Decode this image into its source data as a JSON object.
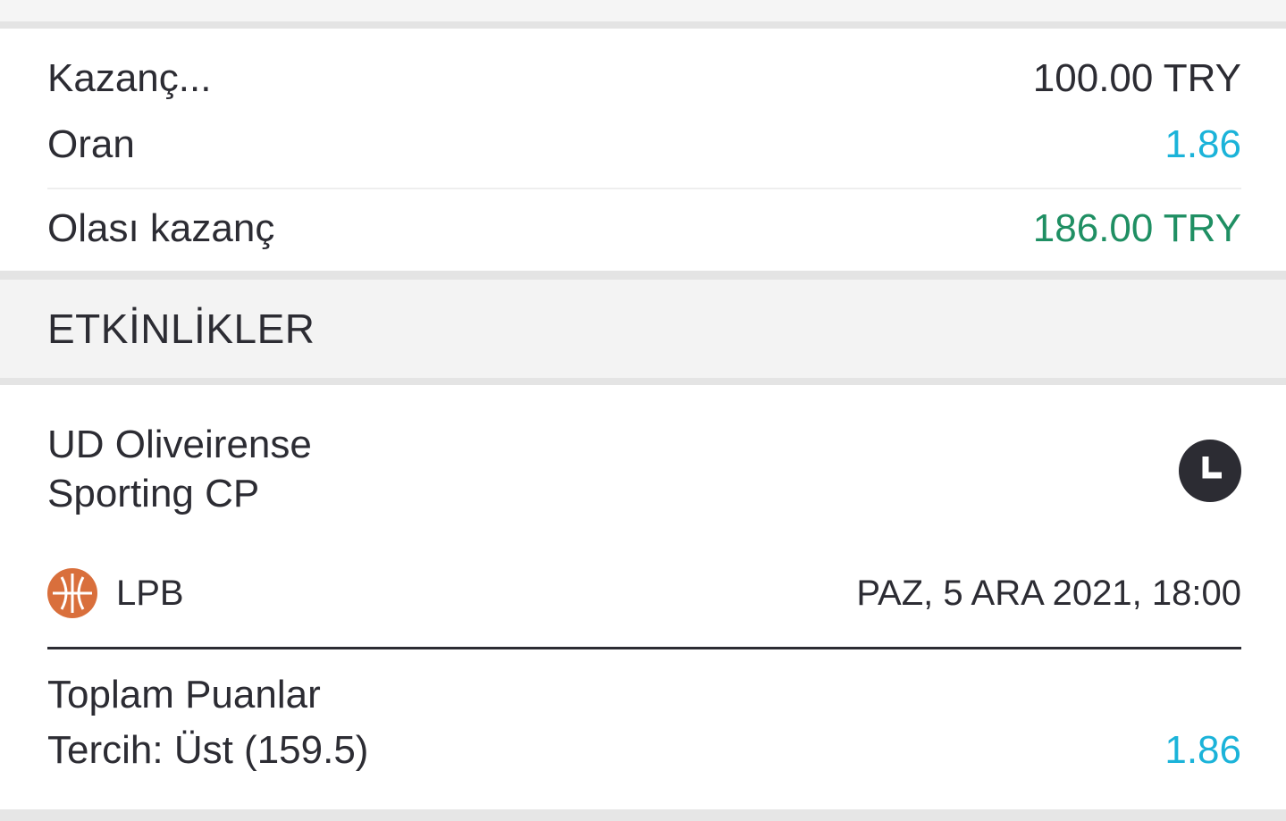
{
  "summary": {
    "stake_label": "Kazanç...",
    "stake_value": "100.00 TRY",
    "odds_label": "Oran",
    "odds_value": "1.86",
    "potential_label": "Olası kazanç",
    "potential_value": "186.00 TRY"
  },
  "events_section": {
    "title": "ETKİNLİKLER"
  },
  "event": {
    "home_team": "UD Oliveirense",
    "away_team": "Sporting CP",
    "status_icon": "clock-icon",
    "sport_icon": "basketball-icon",
    "league": "LPB",
    "datetime": "PAZ, 5 ARA 2021, 18:00",
    "market": "Toplam Puanlar",
    "selection": "Tercih: Üst (159.5)",
    "selection_odds": "1.86"
  },
  "colors": {
    "text": "#2c2c33",
    "odds_blue": "#1bb3d9",
    "win_green": "#1f8f63",
    "basketball_orange": "#d96f3c"
  }
}
